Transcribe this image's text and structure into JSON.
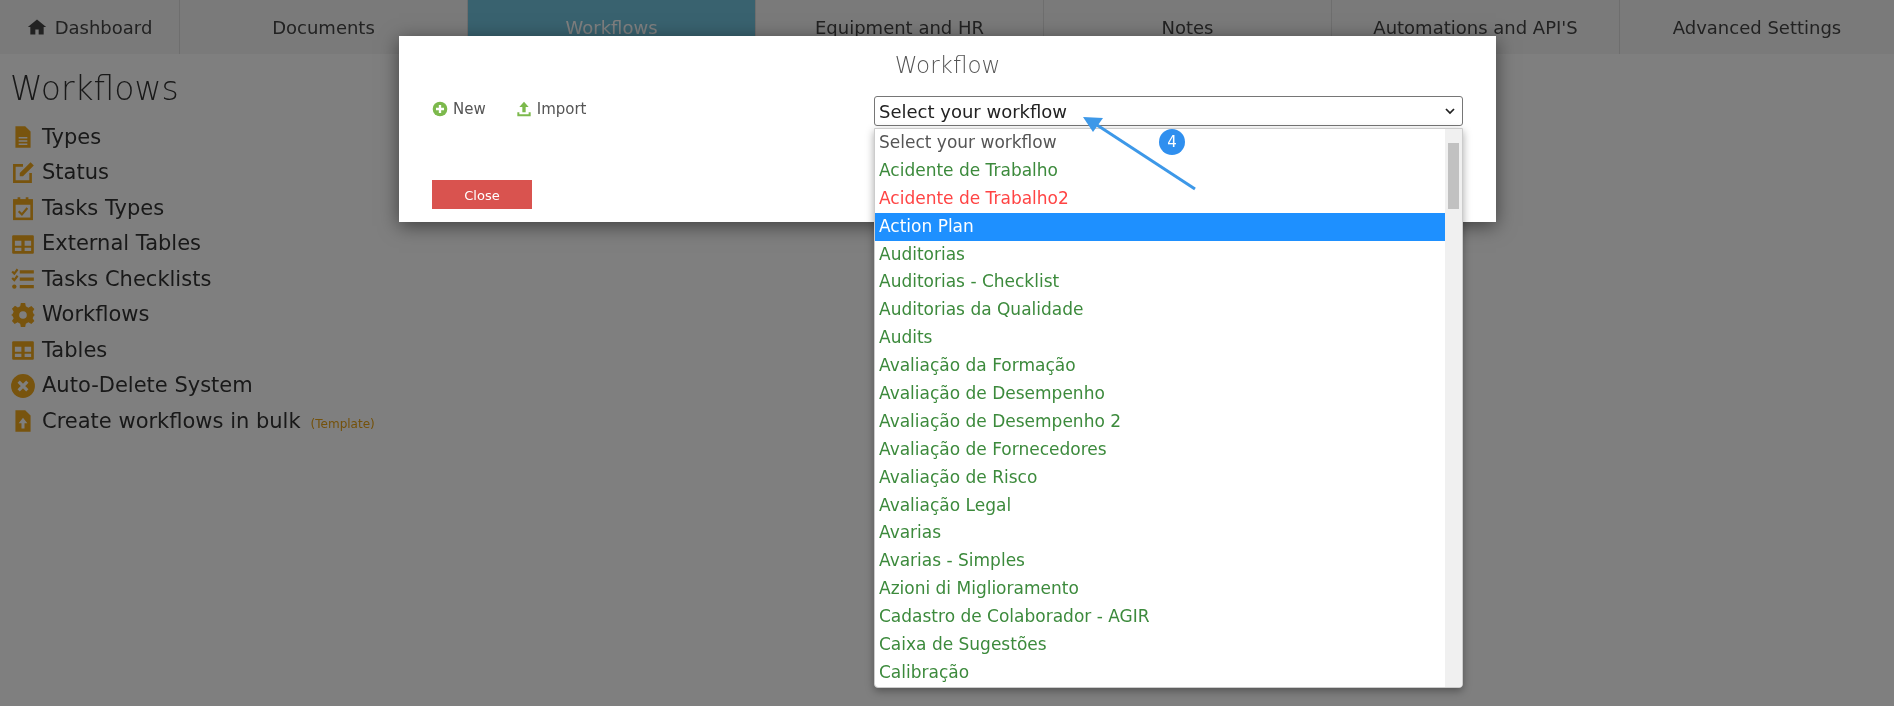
{
  "nav": {
    "tabs": [
      {
        "label": "Dashboard",
        "selected": false
      },
      {
        "label": "Documents",
        "selected": false
      },
      {
        "label": "Workflows",
        "selected": true
      },
      {
        "label": "Equipment and HR",
        "selected": false
      },
      {
        "label": "Notes",
        "selected": false
      },
      {
        "label": "Automations and API'S",
        "selected": false
      },
      {
        "label": "Advanced Settings",
        "selected": false
      }
    ]
  },
  "sidebar": {
    "title": "Workflows",
    "items": [
      {
        "label": "Types"
      },
      {
        "label": "Status"
      },
      {
        "label": "Tasks Types"
      },
      {
        "label": "External Tables"
      },
      {
        "label": "Tasks Checklists"
      },
      {
        "label": "Workflows"
      },
      {
        "label": "Tables"
      },
      {
        "label": "Auto-Delete System"
      },
      {
        "label": "Create workflows in bulk",
        "note": "(Template)"
      }
    ]
  },
  "modal": {
    "title": "Workflow",
    "actions": [
      {
        "label": "New"
      },
      {
        "label": "Import"
      }
    ],
    "select": {
      "value": "Select your workflow",
      "expanded": true
    },
    "options": [
      {
        "label": "Select your workflow",
        "color": "#555555",
        "selected": false
      },
      {
        "label": "Acidente de Trabalho",
        "color": "#3c8a3c",
        "selected": false
      },
      {
        "label": "Acidente de Trabalho2",
        "color": "#ff4444",
        "selected": false
      },
      {
        "label": "Action Plan",
        "selected": true
      },
      {
        "label": "Auditorias",
        "color": "#3c8a3c",
        "selected": false
      },
      {
        "label": "Auditorias - Checklist",
        "color": "#3c8a3c",
        "selected": false
      },
      {
        "label": "Auditorias da Qualidade",
        "color": "#3c8a3c",
        "selected": false
      },
      {
        "label": "Audits",
        "color": "#3c8a3c",
        "selected": false
      },
      {
        "label": "Avaliação da Formação",
        "color": "#3c8a3c",
        "selected": false
      },
      {
        "label": "Avaliação de Desempenho",
        "color": "#3c8a3c",
        "selected": false
      },
      {
        "label": "Avaliação de Desempenho 2",
        "color": "#3c8a3c",
        "selected": false
      },
      {
        "label": "Avaliação de Fornecedores",
        "color": "#3c8a3c",
        "selected": false
      },
      {
        "label": "Avaliação de Risco",
        "color": "#3c8a3c",
        "selected": false
      },
      {
        "label": "Avaliação Legal",
        "color": "#3c8a3c",
        "selected": false
      },
      {
        "label": "Avarias",
        "color": "#3c8a3c",
        "selected": false
      },
      {
        "label": "Avarias - Simples",
        "color": "#3c8a3c",
        "selected": false
      },
      {
        "label": "Azioni di Miglioramento",
        "color": "#3c8a3c",
        "selected": false
      },
      {
        "label": "Cadastro de Colaborador - AGIR",
        "color": "#3c8a3c",
        "selected": false
      },
      {
        "label": "Caixa de Sugestões",
        "color": "#3c8a3c",
        "selected": false
      },
      {
        "label": "Calibração",
        "color": "#3c8a3c",
        "selected": false
      }
    ],
    "close_button": "Close",
    "annotation": {
      "badge": "4"
    }
  }
}
